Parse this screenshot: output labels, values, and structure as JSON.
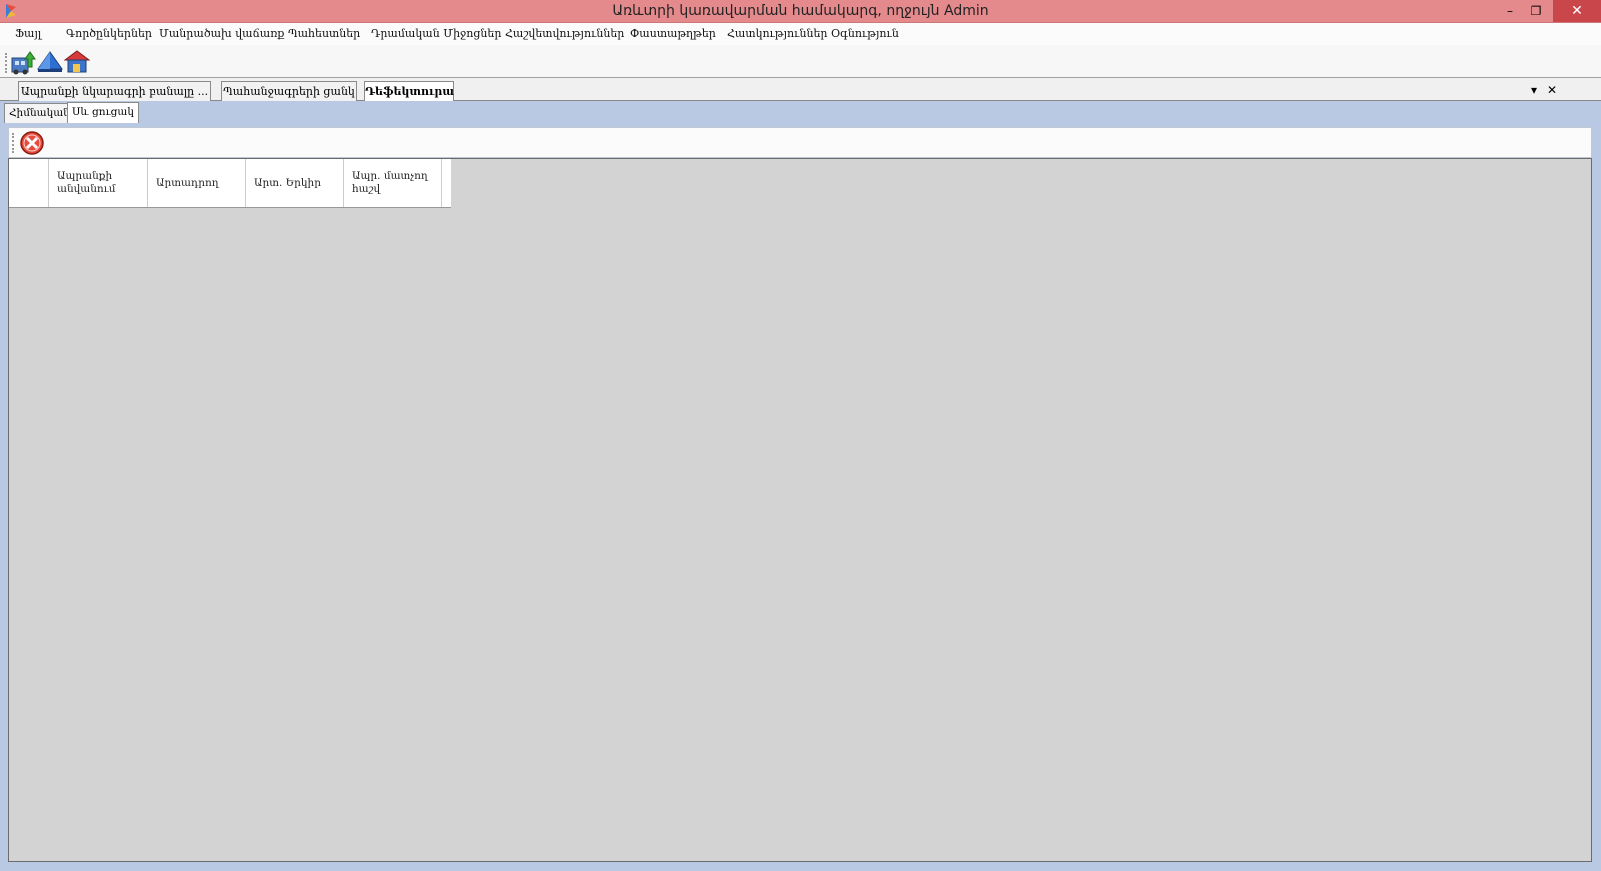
{
  "window": {
    "title": "Առևտրի կառավարման համակարգ, ողջույն Admin",
    "minimize": "–",
    "maximize": "❐",
    "close": "✕"
  },
  "menu": [
    {
      "label": "Ֆայլ"
    },
    {
      "label": "Գործընկերներ"
    },
    {
      "label": "Մանրածախ վաճառք"
    },
    {
      "label": "Պահեստներ"
    },
    {
      "label": "Դրամական Միջոցներ"
    },
    {
      "label": "Հաշվետվություններ"
    },
    {
      "label": "Փաստաթղթեր"
    },
    {
      "label": "Հատկություններ"
    },
    {
      "label": "Օգնություն"
    }
  ],
  "toolbar": {
    "icons": [
      "export-icon",
      "folder-icon",
      "house-icon"
    ]
  },
  "doc_tabs": [
    {
      "label": "Ապրանքի նկարագրի բանալը ..."
    },
    {
      "label": "Պահանջագրերի ցանկ"
    },
    {
      "label": "Դեֆեկտուրա"
    }
  ],
  "doc_tabs_controls": {
    "dropdown": "▾",
    "close": "✕"
  },
  "sub_tabs": [
    {
      "label": "Հիմնական"
    },
    {
      "label": "Սև ցուցակ"
    }
  ],
  "grid": {
    "columns": [
      {
        "label": "Ապրանքի անվանում"
      },
      {
        "label": "Արտադրող"
      },
      {
        "label": "Արտ. Երկիր"
      },
      {
        "label": "Ապր. մատչող հաշվ"
      }
    ],
    "rows": []
  },
  "colors": {
    "titlebar": "#e48a8c",
    "close_button": "#c9474a",
    "panel_bg": "#b9c9e4",
    "grid_bg": "#d3d3d3"
  }
}
